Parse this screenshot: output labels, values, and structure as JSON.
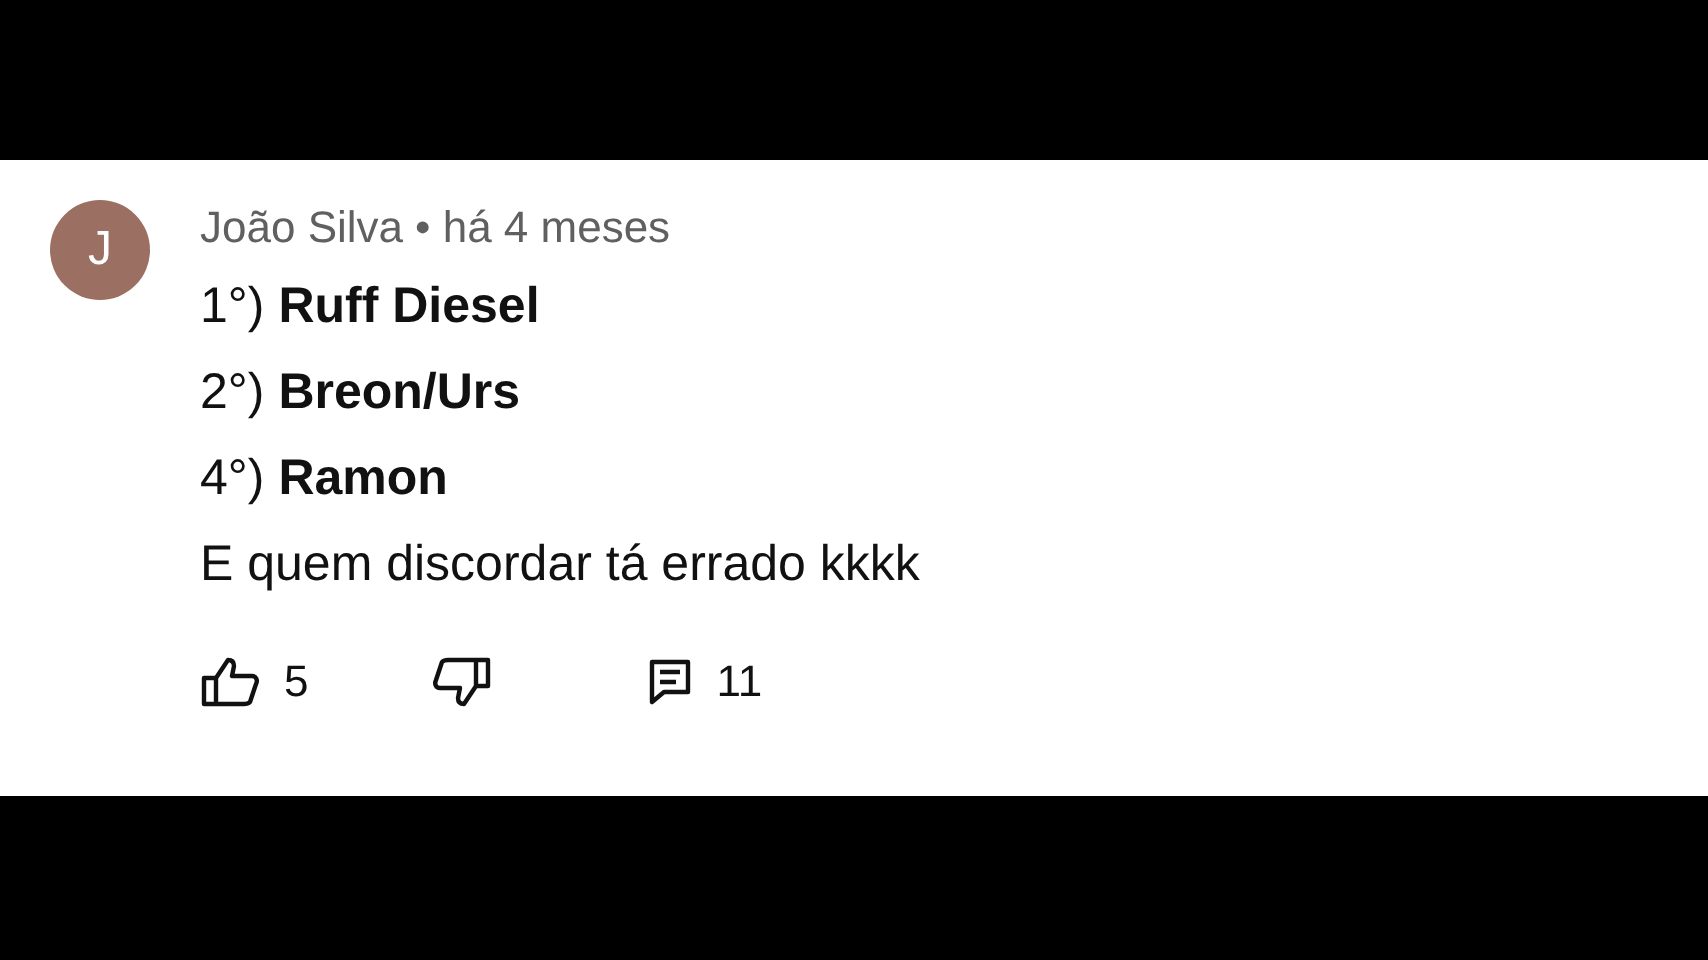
{
  "comment": {
    "avatar_letter": "J",
    "color": "#9c6f63",
    "author": "João Silva",
    "meta": "• há 4 meses",
    "lines": [
      "1°) **Ruff Diesel**",
      "2°) **Breon/Urs**",
      "4°) **Ramon**",
      "E quem discordar tá errado kkkk"
    ],
    "likes": "5",
    "replies": "11"
  }
}
